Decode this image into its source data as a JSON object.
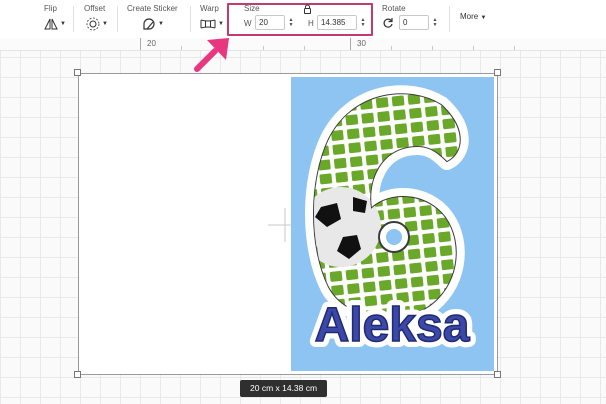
{
  "toolbar": {
    "flip": {
      "label": "Flip",
      "icon": "flip-icon"
    },
    "offset": {
      "label": "Offset",
      "icon": "offset-icon"
    },
    "sticker": {
      "label": "Create Sticker",
      "icon": "sticker-icon"
    },
    "warp": {
      "label": "Warp",
      "icon": "warp-icon"
    },
    "size": {
      "label": "Size",
      "lock_icon": "lock-icon",
      "width_label": "W",
      "width_value": "20",
      "height_label": "H",
      "height_value": "14.385",
      "highlight_color": "#c03a73"
    },
    "rotate": {
      "label": "Rotate",
      "value": "0",
      "icon": "rotate-icon"
    },
    "more_label": "More"
  },
  "ruler": {
    "labels": [
      "20",
      "30"
    ]
  },
  "artwork": {
    "number_glyph": "6",
    "name_text": "Aleksa",
    "background_color": "#8ec4f2",
    "net_color": "#6aa82a",
    "text_color": "#3c48a8"
  },
  "dimensions_pill": "20  cm x 14.38  cm",
  "annotation": {
    "arrow_color": "#e8367f"
  }
}
